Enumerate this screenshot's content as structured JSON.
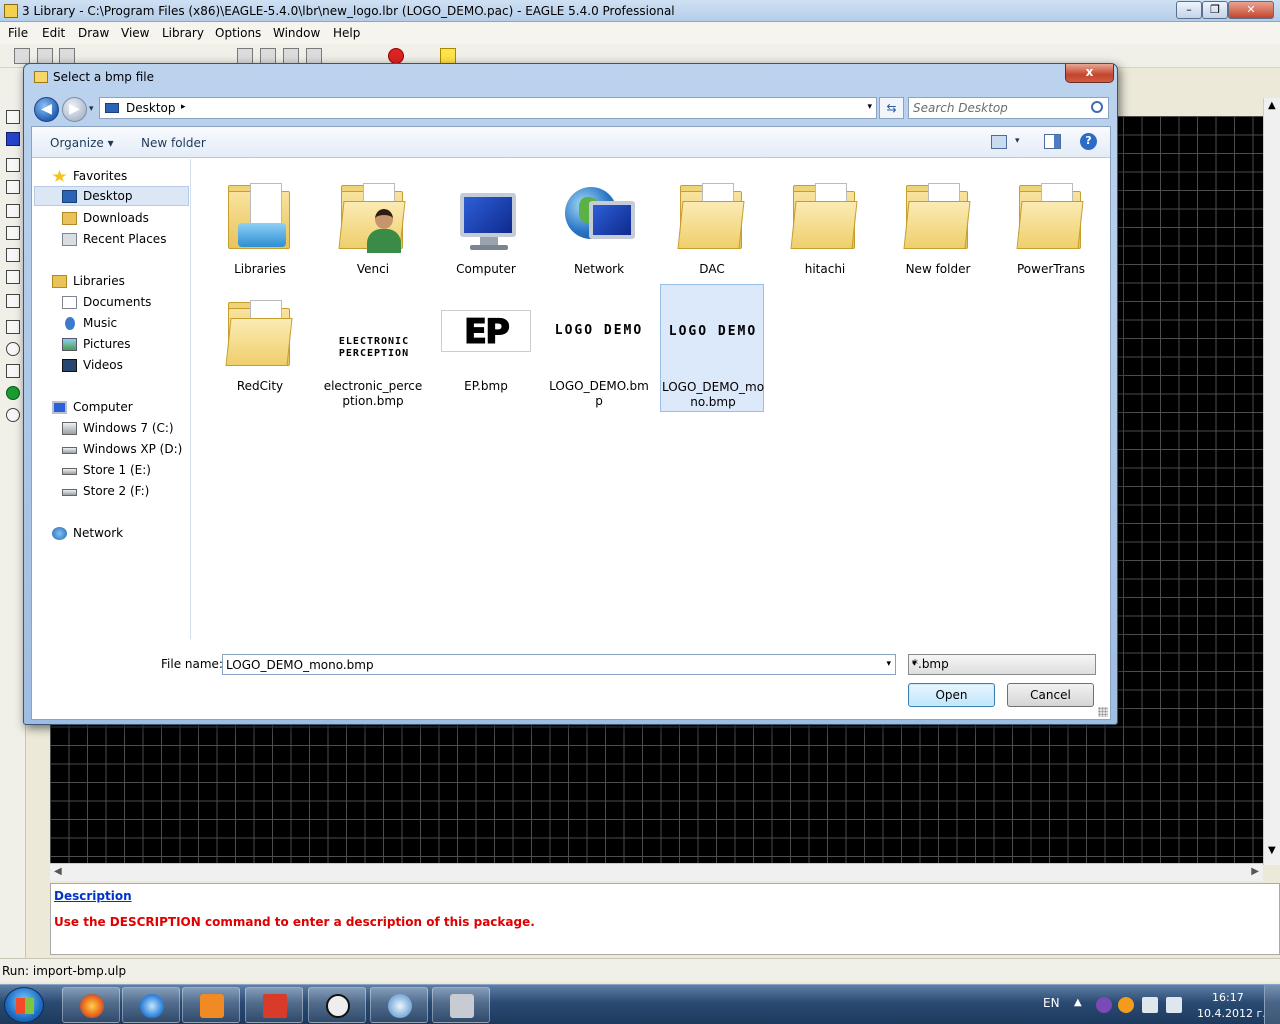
{
  "main_window": {
    "title": "3 Library - C:\\Program Files (x86)\\EAGLE-5.4.0\\lbr\\new_logo.lbr (LOGO_DEMO.pac) - EAGLE 5.4.0 Professional",
    "controls": {
      "minimize": "–",
      "maximize": "❐",
      "close": "✕"
    },
    "menu": [
      "File",
      "Edit",
      "Draw",
      "View",
      "Library",
      "Options",
      "Window",
      "Help"
    ],
    "description_panel": {
      "link": "Description",
      "message": "Use the DESCRIPTION command to enter a description of this package."
    },
    "status": "Run: import-bmp.ulp",
    "colors": {
      "grid_bg": "#000000",
      "grid_line": "#4d4d4d",
      "message": "#e00000",
      "link": "#0033cc"
    }
  },
  "dialog": {
    "title": "Select a bmp file",
    "close_label": "x",
    "address": {
      "location": "Desktop",
      "sep_arrow": "▸",
      "dropdown": "▾"
    },
    "back_glyph": "◀",
    "forward_glyph": "▶",
    "history_glyph": "▾",
    "refresh_glyph": "⇆",
    "search_placeholder": "Search Desktop",
    "toolbar": {
      "organize": "Organize ▾",
      "new_folder": "New folder",
      "views_dd": "▾",
      "help": "?"
    },
    "nav": [
      {
        "label": "Favorites",
        "icon": "star-icon",
        "group": true
      },
      {
        "label": "Desktop",
        "icon": "desktop-icon",
        "selected": true
      },
      {
        "label": "Downloads",
        "icon": "downloads-folder-icon"
      },
      {
        "label": "Recent Places",
        "icon": "recent-places-icon"
      },
      {
        "label": "Libraries",
        "icon": "libraries-icon",
        "group": true
      },
      {
        "label": "Documents",
        "icon": "documents-icon"
      },
      {
        "label": "Music",
        "icon": "music-icon"
      },
      {
        "label": "Pictures",
        "icon": "pictures-icon"
      },
      {
        "label": "Videos",
        "icon": "videos-icon"
      },
      {
        "label": "Computer",
        "icon": "computer-icon",
        "group": true
      },
      {
        "label": "Windows 7 (C:)",
        "icon": "drive-icon"
      },
      {
        "label": "Windows XP (D:)",
        "icon": "drive-icon"
      },
      {
        "label": "Store 1 (E:)",
        "icon": "drive-icon"
      },
      {
        "label": "Store 2 (F:)",
        "icon": "drive-icon"
      },
      {
        "label": "Network",
        "icon": "network-icon",
        "group": true
      }
    ],
    "items": [
      {
        "label": "Libraries",
        "kind": "libraries-folder"
      },
      {
        "label": "Venci",
        "kind": "user-folder"
      },
      {
        "label": "Computer",
        "kind": "computer"
      },
      {
        "label": "Network",
        "kind": "network"
      },
      {
        "label": "DAC",
        "kind": "folder"
      },
      {
        "label": "hitachi",
        "kind": "folder"
      },
      {
        "label": "New folder",
        "kind": "folder"
      },
      {
        "label": "PowerTrans",
        "kind": "folder"
      },
      {
        "label": "RedCity",
        "kind": "folder"
      },
      {
        "label": "electronic_perception.bmp",
        "kind": "bmp",
        "preview_text": "ELECTRONIC PERCEPTION"
      },
      {
        "label": "EP.bmp",
        "kind": "bmp",
        "preview_text": "EP"
      },
      {
        "label": "LOGO_DEMO.bmp",
        "kind": "bmp",
        "preview_text": "LOGO DEMO"
      },
      {
        "label": "LOGO_DEMO_mono.bmp",
        "kind": "bmp",
        "preview_text": "LOGO DEMO",
        "selected": true
      }
    ],
    "file_name_label": "File name:",
    "file_name_value": "LOGO_DEMO_mono.bmp",
    "filter": "*.bmp",
    "dropdown_glyph": "▾",
    "open_label": "Open",
    "cancel_label": "Cancel"
  },
  "scroll_glyphs": {
    "up": "▲",
    "down": "▼",
    "left": "◀",
    "right": "▶"
  },
  "taskbar": {
    "lang": "EN",
    "tray_arrow": "▲",
    "time": "16:17",
    "date": "10.4.2012 г."
  }
}
